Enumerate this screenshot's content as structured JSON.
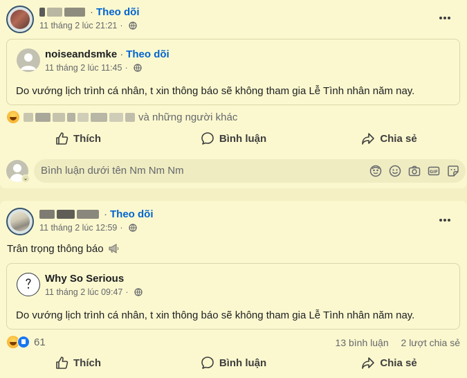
{
  "post1": {
    "author_name": "",
    "follow_label": "Theo dõi",
    "timestamp": "11 tháng 2 lúc 21:21",
    "shared": {
      "author_name": "noiseandsmke",
      "follow_label": "Theo dõi",
      "timestamp": "11 tháng 2 lúc 11:45",
      "text": "Do vướng lịch trình cá nhân, t xin thông báo sẽ không tham gia Lễ Tình nhân năm nay."
    },
    "reactions_suffix": "và những người khác",
    "actions": {
      "like": "Thích",
      "comment": "Bình luận",
      "share": "Chia sẻ"
    },
    "comment_placeholder": "Bình luận dưới tên Nm Nm Nm"
  },
  "post2": {
    "author_name": "",
    "follow_label": "Theo dõi",
    "timestamp": "11 tháng 2 lúc 12:59",
    "caption": "Trân trọng thông báo",
    "shared": {
      "author_name": "Why So Serious",
      "timestamp": "11 tháng 2 lúc 09:47",
      "text": "Do vướng lịch trình cá nhân, t xin thông báo sẽ không tham gia Lễ Tình nhân năm nay."
    },
    "reaction_count": "61",
    "comments_count": "13 bình luận",
    "shares_count": "2 lượt chia sẻ",
    "actions": {
      "like": "Thích",
      "comment": "Bình luận",
      "share": "Chia sẻ"
    }
  },
  "icons": {
    "globe": "globe-icon",
    "more": "more-options-icon",
    "like": "thumbs-up-icon",
    "comment": "speech-bubble-icon",
    "share": "share-arrow-icon",
    "avatar_sticker": "avatar-sticker-icon",
    "emoji": "smiley-icon",
    "camera": "camera-icon",
    "gif": "gif-icon",
    "sticker": "sticker-icon",
    "megaphone": "megaphone-icon"
  },
  "colors": {
    "background": "#f4f0c4",
    "card": "#fbf8cf",
    "link": "#0064d1",
    "meta": "#65676b"
  }
}
